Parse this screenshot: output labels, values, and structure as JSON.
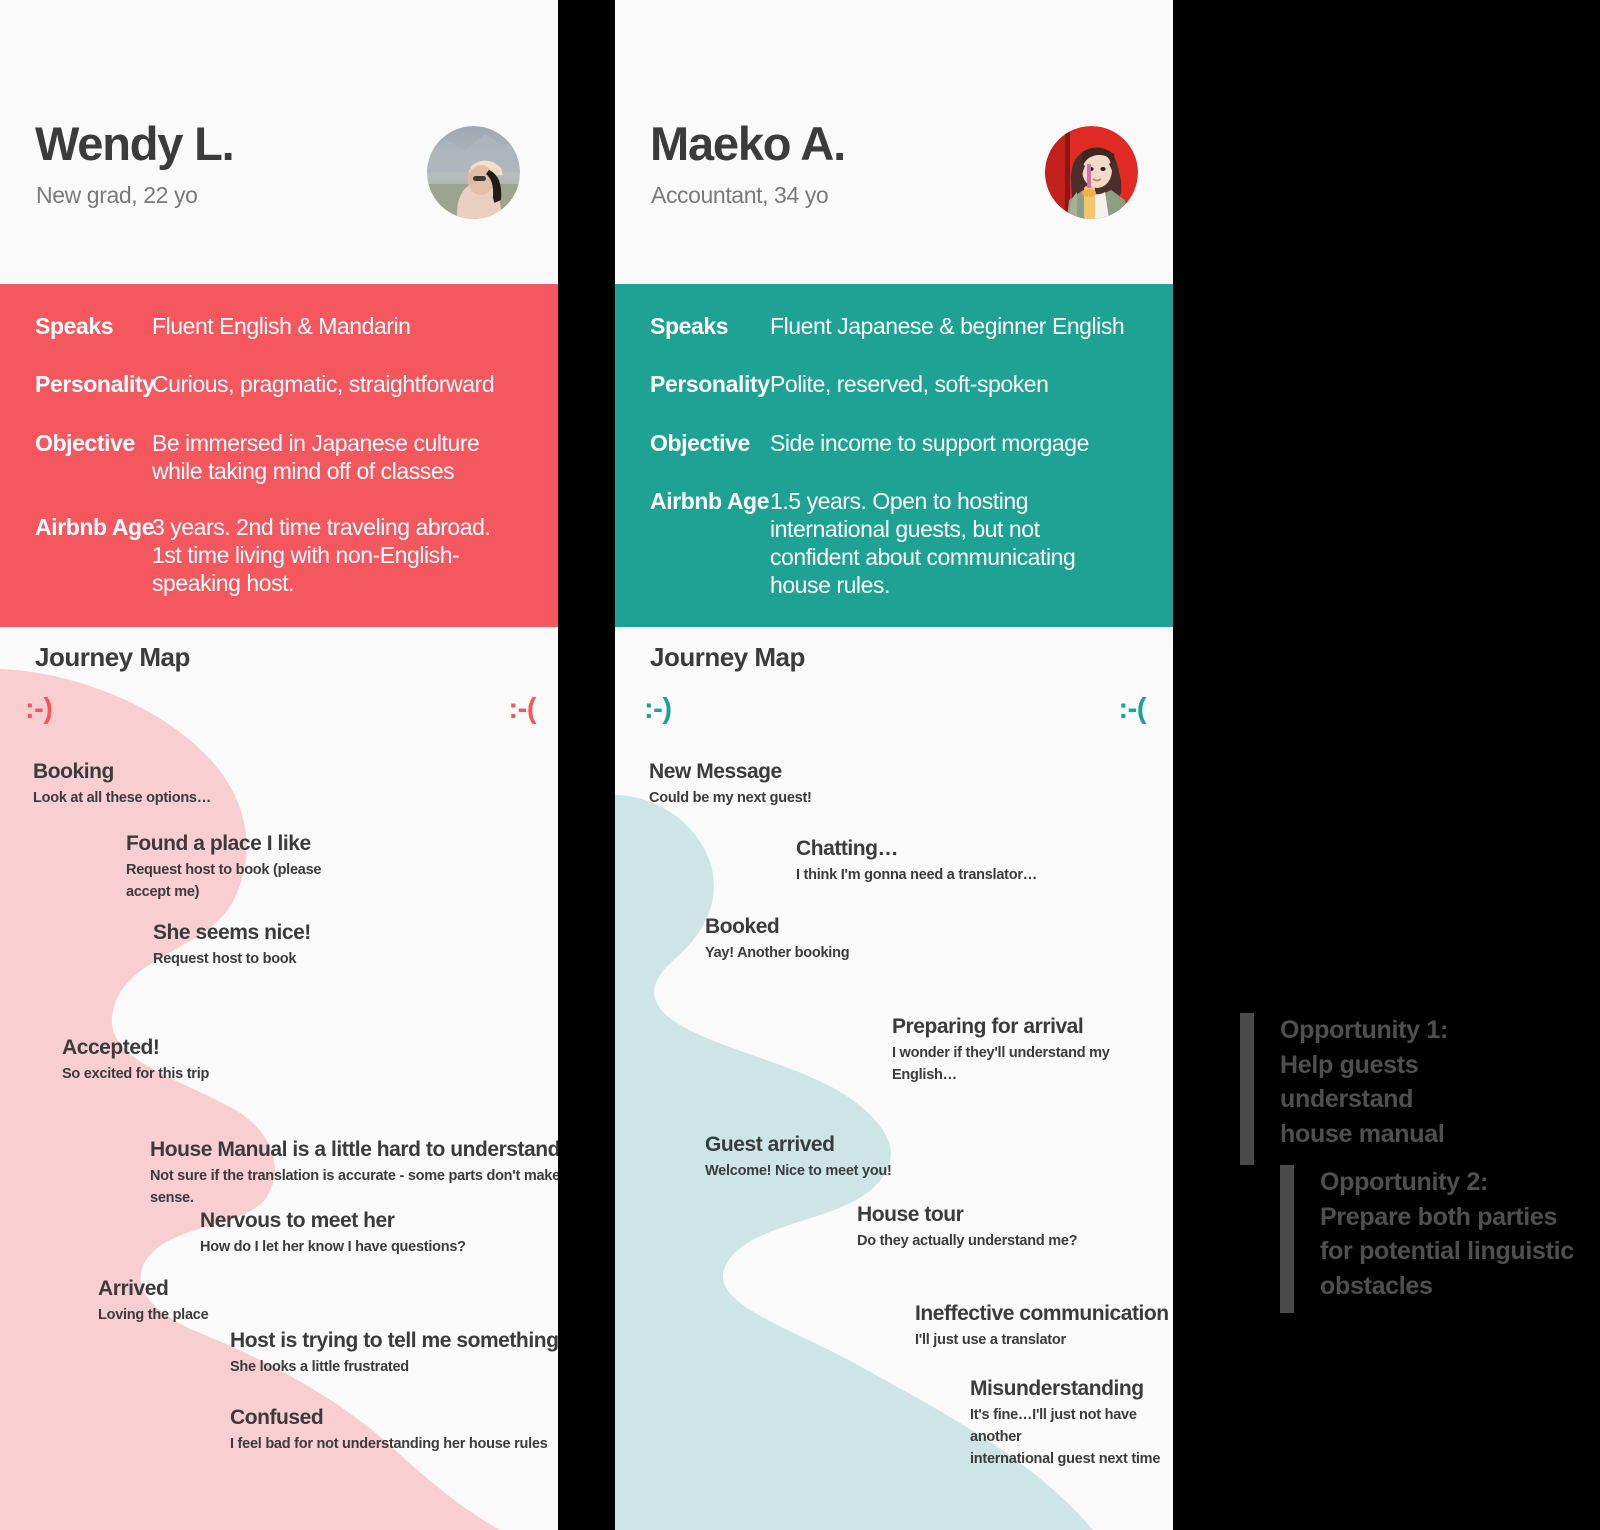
{
  "colors": {
    "wendy_accent": "#F5575F",
    "wendy_wave": "#F8CED0",
    "maeko_accent": "#1DA294",
    "maeko_wave": "#CDE6E5",
    "card_bg": "#FAFAFA",
    "page_bg": "#000000",
    "text_dark": "#3B3B3B",
    "text_muted": "#7A7A7A",
    "opportunity_text": "#4F4F4F",
    "opportunity_bar": "#4A4A4A"
  },
  "personas": [
    {
      "id": "wendy",
      "name": "Wendy L.",
      "role": "New grad, 22 yo",
      "avatar_name": "wendy-avatar-photo",
      "attributes": [
        {
          "key": "Speaks",
          "value": "Fluent English & Mandarin"
        },
        {
          "key": "Personality",
          "value": "Curious, pragmatic, straightforward"
        },
        {
          "key": "Objective",
          "value": "Be immersed in Japanese culture\nwhile taking mind off of classes"
        },
        {
          "key": "Airbnb Age",
          "value": "3 years. 2nd time traveling abroad.\n1st time living with non-English-\nspeaking host."
        }
      ],
      "journey": {
        "title": "Journey Map",
        "happy_face": ":-)",
        "sad_face": ":-(",
        "stages": [
          {
            "title": "Booking",
            "desc": "Look at all these options…"
          },
          {
            "title": "Found a place I like",
            "desc": "Request host to book (please\naccept me)"
          },
          {
            "title": "She seems nice!",
            "desc": "Request host to book"
          },
          {
            "title": "Accepted!",
            "desc": "So excited for this trip"
          },
          {
            "title": "House Manual is a little hard to understand",
            "desc": "Not sure if the translation is accurate - some parts don't make sense."
          },
          {
            "title": "Nervous to meet her",
            "desc": "How do I let her know I have questions?"
          },
          {
            "title": "Arrived",
            "desc": "Loving the place"
          },
          {
            "title": "Host is trying to tell me something…",
            "desc": "She looks a little frustrated"
          },
          {
            "title": "Confused",
            "desc": "I feel bad for not understanding her house rules"
          }
        ]
      }
    },
    {
      "id": "maeko",
      "name": "Maeko A.",
      "role": "Accountant, 34 yo",
      "avatar_name": "maeko-avatar-photo",
      "attributes": [
        {
          "key": "Speaks",
          "value": "Fluent Japanese & beginner English"
        },
        {
          "key": "Personality",
          "value": "Polite, reserved, soft-spoken"
        },
        {
          "key": "Objective",
          "value": "Side income to support morgage"
        },
        {
          "key": "Airbnb Age",
          "value": "1.5 years. Open to hosting\ninternational guests, but not\nconfident about communicating\nhouse rules."
        }
      ],
      "journey": {
        "title": "Journey Map",
        "happy_face": ":-)",
        "sad_face": ":-(",
        "stages": [
          {
            "title": "New Message",
            "desc": "Could be my next guest!"
          },
          {
            "title": "Chatting…",
            "desc": "I think I'm gonna need a translator…"
          },
          {
            "title": "Booked",
            "desc": "Yay! Another booking"
          },
          {
            "title": "Preparing for arrival",
            "desc": "I wonder if they'll understand my\nEnglish…"
          },
          {
            "title": "Guest arrived",
            "desc": "Welcome! Nice to meet you!"
          },
          {
            "title": "House tour",
            "desc": "Do they actually understand me?"
          },
          {
            "title": "Ineffective communication",
            "desc": "I'll just use a translator"
          },
          {
            "title": "Misunderstanding",
            "desc": "It's fine…I'll just not have another\ninternational guest next time"
          }
        ]
      }
    }
  ],
  "opportunities": [
    {
      "text": "Opportunity 1:\nHelp guests\nunderstand\nhouse manual"
    },
    {
      "text": "Opportunity 2:\nPrepare both parties\nfor potential linguistic\nobstacles"
    }
  ]
}
